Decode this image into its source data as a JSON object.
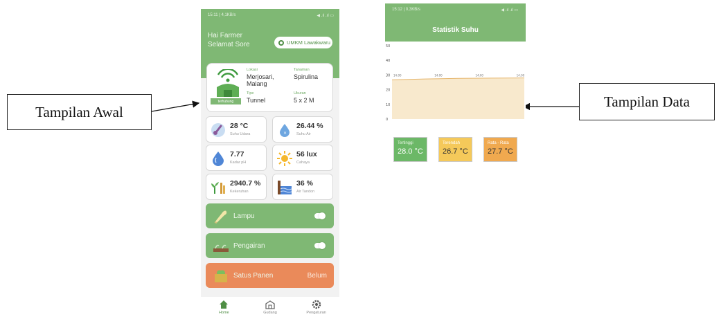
{
  "callouts": {
    "left": "Tampilan Awal",
    "right": "Tampilan Data"
  },
  "home": {
    "statusbar": {
      "left": "15:11 | 4,1KB/s",
      "right": "◀ .ıl .ıl ▭"
    },
    "greeting": [
      "Hai Farmer",
      "Selamat Sore"
    ],
    "location_pill": "UMKM Lawakwaru",
    "info": {
      "lokasi_label": "Lokasi",
      "lokasi_value": "Merjosari, Malang",
      "tanaman_label": "Tanaman",
      "tanaman_value": "Spirulina",
      "tipe_label": "Tipe",
      "tipe_value": "Tunnel",
      "ukuran_label": "Ukuran",
      "ukuran_value": "5 x 2 M",
      "badge": "terhubung"
    },
    "tiles": [
      {
        "value": "28 °C",
        "label": "Suhu Udara",
        "icon": "thermometer-icon"
      },
      {
        "value": "26.44 %",
        "label": "Suhu Air",
        "icon": "water-drop-icon"
      },
      {
        "value": "7.77",
        "label": "Kadar pH",
        "icon": "ph-drop-icon"
      },
      {
        "value": "56 lux",
        "label": "Cahaya",
        "icon": "sun-icon"
      },
      {
        "value": "2940.7 %",
        "label": "Kekeruhan",
        "icon": "plant-icon"
      },
      {
        "value": "36 %",
        "label": "Air Tandon",
        "icon": "water-tank-icon"
      }
    ],
    "controls": {
      "lampu": "Lampu",
      "pengairan": "Pengairan",
      "panen_label": "Satus Panen",
      "panen_value": "Belum"
    },
    "nav": [
      "Home",
      "Gudang",
      "Pengaturan"
    ]
  },
  "stats": {
    "statusbar": {
      "left": "15:12 | 0,3KB/s",
      "right": "◀ .ıl .ıl ▭"
    },
    "title": "Statistik Suhu",
    "summary": [
      {
        "label": "Tertinggi",
        "value": "28.0 °C",
        "color": "#6cb867"
      },
      {
        "label": "Terendah",
        "value": "26.7 °C",
        "color": "#f5c95a"
      },
      {
        "label": "Rata - Rata",
        "value": "27.7 °C",
        "color": "#f0a94f"
      }
    ]
  },
  "chart_data": {
    "type": "area",
    "y_ticks": [
      "50",
      "40",
      "30",
      "20",
      "10",
      "0"
    ],
    "x_ticks": [
      "14:00",
      "14:00",
      "14:00",
      "14:00"
    ],
    "ylim": [
      0,
      50
    ],
    "values": [
      26.7,
      27.3,
      27.7,
      27.9,
      28.0
    ],
    "fill": "#f8e9cd",
    "line": "#e5b46a"
  }
}
